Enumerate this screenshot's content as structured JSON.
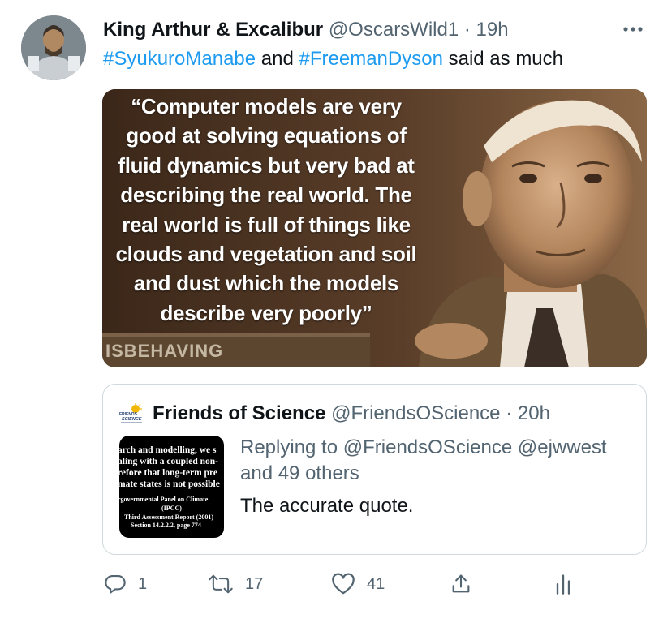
{
  "tweet": {
    "author_name": "King Arthur & Excalibur",
    "handle": "@OscarsWild1",
    "separator": "·",
    "time": "19h",
    "more_icon": "more-horizontal-icon",
    "text": {
      "hashtag1": "#SyukuroManabe",
      "connector": " and ",
      "hashtag2": "#FreemanDyson",
      "suffix": " said as much"
    }
  },
  "media": {
    "quote_lines": [
      "“Computer models are very",
      "good at solving equations of",
      "fluid dynamics but very bad at",
      "describing the real world. The",
      "real world is full of things like",
      "clouds and vegetation and soil",
      "and dust which the models",
      "describe very poorly”"
    ],
    "shelf_text": "ISBEHAVING"
  },
  "quoted_tweet": {
    "logo_text": [
      "FRIENDS",
      "SCIENCE"
    ],
    "author_name": "Friends of Science",
    "handle": "@FriendsOScience",
    "separator": "·",
    "time": "20h",
    "thumbnail_lines": [
      "arch and modelling, we s",
      "aling with a coupled non-",
      "refore that long-term pre",
      "mate states is not possible",
      "rgovernmental Panel on Climate",
      "(IPCC)",
      "Third Assessment Report (2001)",
      "Section 14.2.2.2, page 774"
    ],
    "replying_to_label": "Replying to ",
    "replying_to_users": "@FriendsOScience @ejwwest",
    "replying_to_others": "and 49 others",
    "text": "The accurate quote."
  },
  "actions": {
    "reply_count": "1",
    "retweet_count": "17",
    "like_count": "41",
    "colors": {
      "icon": "#536471",
      "link": "#1d9bf0"
    }
  }
}
